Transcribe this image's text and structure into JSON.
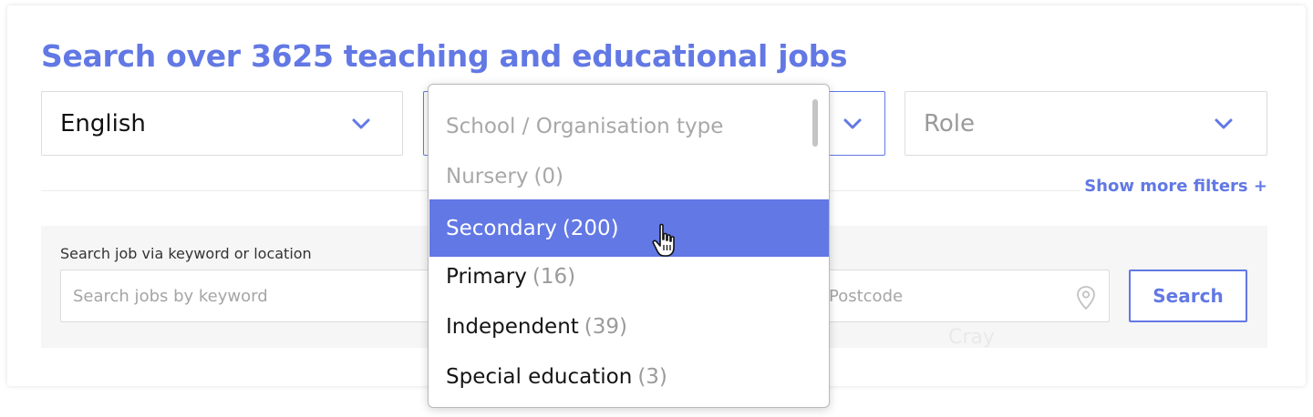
{
  "page": {
    "title": "Search over 3625 teaching and educational jobs"
  },
  "filters": {
    "subject": {
      "value": "English"
    },
    "school_type": {
      "placeholder": "School / Organisation type"
    },
    "role": {
      "placeholder": "Role"
    },
    "show_more_label": "Show more filters +"
  },
  "search": {
    "label": "Search job via keyword or location",
    "keyword_placeholder": "Search jobs by keyword",
    "postcode_placeholder": "Postcode",
    "button_label": "Search",
    "ghost_text": "Cray"
  },
  "dropdown": {
    "header": "School / Organisation type",
    "options": [
      {
        "label": "Nursery",
        "count": "(0)",
        "state": "disabled"
      },
      {
        "label": "Secondary",
        "count": "(200)",
        "state": "highlighted"
      },
      {
        "label": "Primary",
        "count": "(16)",
        "state": "normal"
      },
      {
        "label": "Independent",
        "count": "(39)",
        "state": "normal"
      },
      {
        "label": "Special education",
        "count": "(3)",
        "state": "normal"
      }
    ]
  },
  "colors": {
    "accent": "#6278e4",
    "placeholder": "#9a9a9a",
    "border": "#dcdcdc"
  },
  "icons": {
    "chevron": "chevron-down-icon",
    "location": "location-pin-icon",
    "cursor": "hand-pointer-icon"
  }
}
